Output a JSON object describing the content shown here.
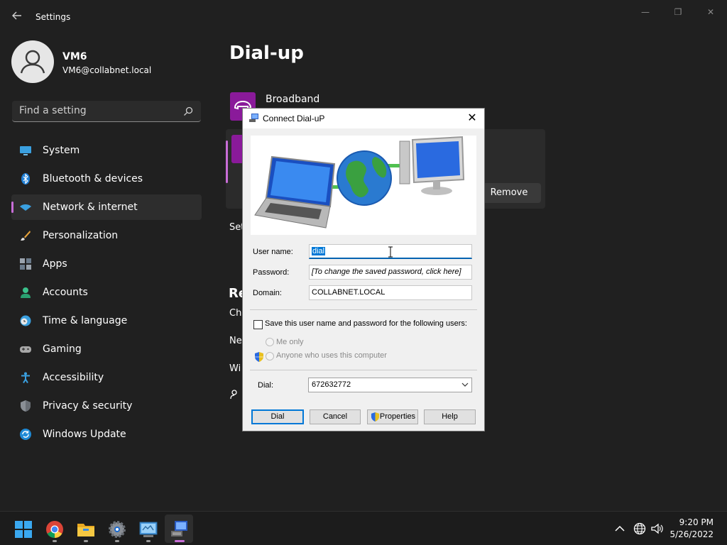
{
  "window": {
    "app_title": "Settings",
    "minimize_glyph": "—",
    "maximize_glyph": "❐",
    "close_glyph": "✕"
  },
  "user": {
    "name": "VM6",
    "email": "VM6@collabnet.local"
  },
  "search": {
    "placeholder": "Find a setting"
  },
  "sidebar": {
    "items": [
      {
        "label": "System",
        "icon": "monitor-icon"
      },
      {
        "label": "Bluetooth & devices",
        "icon": "bluetooth-icon"
      },
      {
        "label": "Network & internet",
        "icon": "wifi-icon",
        "active": true
      },
      {
        "label": "Personalization",
        "icon": "brush-icon"
      },
      {
        "label": "Apps",
        "icon": "apps-icon"
      },
      {
        "label": "Accounts",
        "icon": "person-icon"
      },
      {
        "label": "Time & language",
        "icon": "globe-clock-icon"
      },
      {
        "label": "Gaming",
        "icon": "gamepad-icon"
      },
      {
        "label": "Accessibility",
        "icon": "accessibility-icon"
      },
      {
        "label": "Privacy & security",
        "icon": "shield-icon"
      },
      {
        "label": "Windows Update",
        "icon": "update-icon"
      }
    ]
  },
  "main": {
    "title": "Dial-up",
    "connection_name": "Broadband",
    "remove_label": "Remove",
    "partial_settings": "Set",
    "partial_related": "Re",
    "partial_ch": "Ch",
    "partial_ne": "Ne",
    "partial_wi": "Wi"
  },
  "dialog": {
    "title": "Connect Dial-uP",
    "username_label": "User name:",
    "username_value": "dial",
    "password_label": "Password:",
    "password_placeholder": "[To change the saved password, click here]",
    "domain_label": "Domain:",
    "domain_value": "COLLABNET.LOCAL",
    "save_checkbox_label": "Save this user name and password for the following users:",
    "save_checked": false,
    "radio_me_only": "Me only",
    "radio_anyone": "Anyone who uses this computer",
    "dial_label": "Dial:",
    "dial_value": "672632772",
    "buttons": {
      "dial": "Dial",
      "cancel": "Cancel",
      "properties": "Properties",
      "help": "Help"
    }
  },
  "taskbar": {
    "apps": [
      "start-icon",
      "chrome-icon",
      "file-explorer-icon",
      "settings-icon",
      "control-panel-icon",
      "dialup-connection-icon"
    ],
    "time": "9:20 PM",
    "date": "5/26/2022"
  },
  "colors": {
    "accent": "#c86dd7",
    "connection_icon_bg": "#8a1a9a",
    "selection": "#0078d7"
  }
}
